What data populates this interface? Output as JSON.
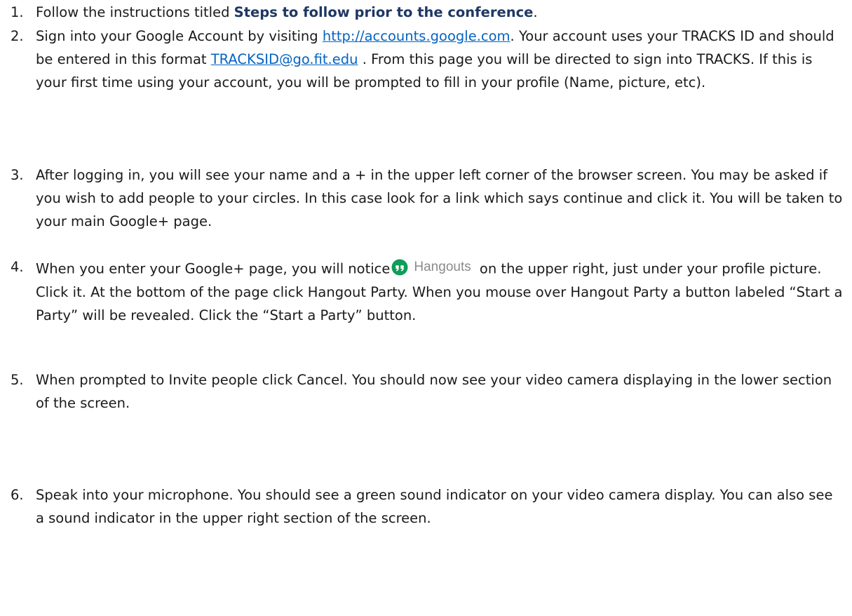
{
  "steps": [
    {
      "number": "1.",
      "before": "Follow the instructions titled ",
      "bold": "Steps to follow prior to the conference",
      "after": "."
    },
    {
      "number": "2.",
      "part1": "Sign into your Google Account by visiting ",
      "link1": "http://accounts.google.com",
      "part2": ". Your account uses your TRACKS ID and should be entered in this format ",
      "link2": "TRACKSID@go.fit.edu",
      "part3": " . From this page you will be directed to sign into TRACKS. If this is your first time using your account, you will be prompted to fill in your profile (Name, picture, etc)."
    },
    {
      "number": "3.",
      "text": "After logging in, you will see your name and a + in the upper left corner of the browser screen. You may be asked if you wish to add people to your circles. In this case look for a link which says continue and click it. You will be taken to your main Google+ page."
    },
    {
      "number": "4.",
      "before": "When you enter your Google+ page, you will notice",
      "icon_name": "hangouts-icon",
      "icon_color": "#0f9d58",
      "hangouts_label": "Hangouts",
      "after": " on the upper right, just under your profile picture. Click it. At the bottom of the page click Hangout Party. When you mouse over Hangout Party a button labeled “Start a Party” will be revealed. Click the “Start a Party” button."
    },
    {
      "number": "5.",
      "text": "When prompted to Invite people click Cancel.  You should now see your video camera displaying in the lower section of the screen."
    },
    {
      "number": "6.",
      "text": "Speak into your microphone. You should see a green sound indicator on your video camera display. You can also see a sound indicator in the upper right section of the screen."
    }
  ]
}
